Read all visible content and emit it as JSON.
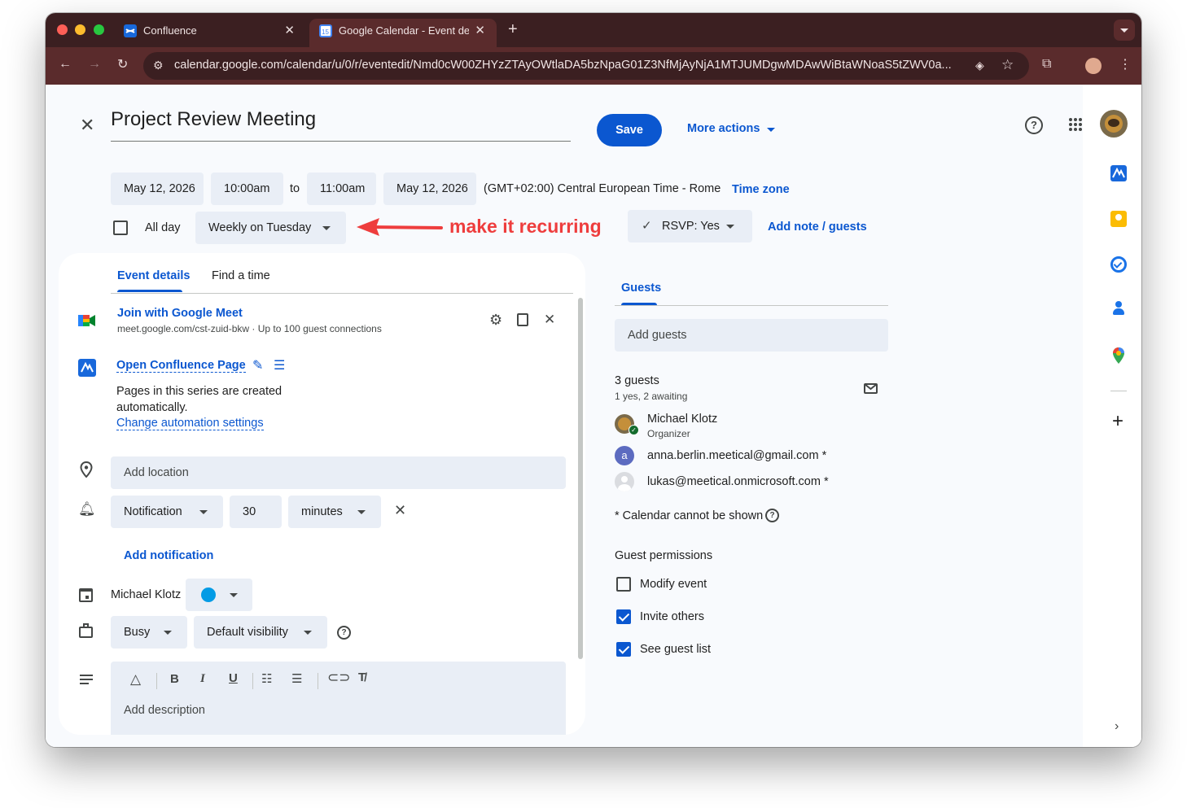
{
  "browser": {
    "tabs": [
      {
        "label": "Confluence",
        "active": false
      },
      {
        "label": "Google Calendar - Event deta",
        "active": true
      }
    ],
    "url": "calendar.google.com/calendar/u/0/r/eventedit/Nmd0cW00ZHYzZTAyOWtlaDA5bzNpaG01Z3NfMjAyNjA1MTJUMDgwMDAwWiBtaWNoaS5tZWV0a..."
  },
  "header": {
    "title": "Project Review Meeting",
    "save_label": "Save",
    "more_actions_label": "More actions"
  },
  "datetime": {
    "start_date": "May 12, 2026",
    "start_time": "10:00am",
    "to_label": "to",
    "end_time": "11:00am",
    "end_date": "May 12, 2026",
    "timezone": "(GMT+02:00) Central European Time - Rome",
    "timezone_link": "Time zone",
    "all_day_label": "All day",
    "all_day_checked": false,
    "recurrence": "Weekly on Tuesday",
    "rsvp": "RSVP: Yes",
    "add_note_link": "Add note / guests"
  },
  "annotation": {
    "text": "make it recurring",
    "color": "#ee3d3d"
  },
  "tabs": {
    "event_details": "Event details",
    "find_time": "Find a time",
    "guests": "Guests"
  },
  "meet": {
    "title": "Join with Google Meet",
    "subtitle": "meet.google.com/cst-zuid-bkw · Up to 100 guest connections"
  },
  "confluence": {
    "link": "Open Confluence Page",
    "desc_line1": "Pages in this series are created",
    "desc_line2": "automatically.",
    "settings_link": "Change automation settings"
  },
  "location": {
    "placeholder": "Add location"
  },
  "notification": {
    "type": "Notification",
    "value": "30",
    "unit": "minutes",
    "add_label": "Add notification"
  },
  "calendar": {
    "owner": "Michael Klotz",
    "color": "#039be5"
  },
  "availability": {
    "status": "Busy",
    "visibility": "Default visibility"
  },
  "description": {
    "placeholder": "Add description"
  },
  "guests": {
    "add_placeholder": "Add guests",
    "count_label": "3 guests",
    "summary": "1 yes, 2 awaiting",
    "list": [
      {
        "name": "Michael Klotz",
        "role": "Organizer"
      },
      {
        "name": "anna.berlin.meetical@gmail.com *",
        "initial": "a"
      },
      {
        "name": "lukas@meetical.onmicrosoft.com *"
      }
    ],
    "calendar_note": "* Calendar cannot be shown",
    "permissions_title": "Guest permissions",
    "permissions": [
      {
        "label": "Modify event",
        "checked": false
      },
      {
        "label": "Invite others",
        "checked": true
      },
      {
        "label": "See guest list",
        "checked": true
      }
    ]
  }
}
